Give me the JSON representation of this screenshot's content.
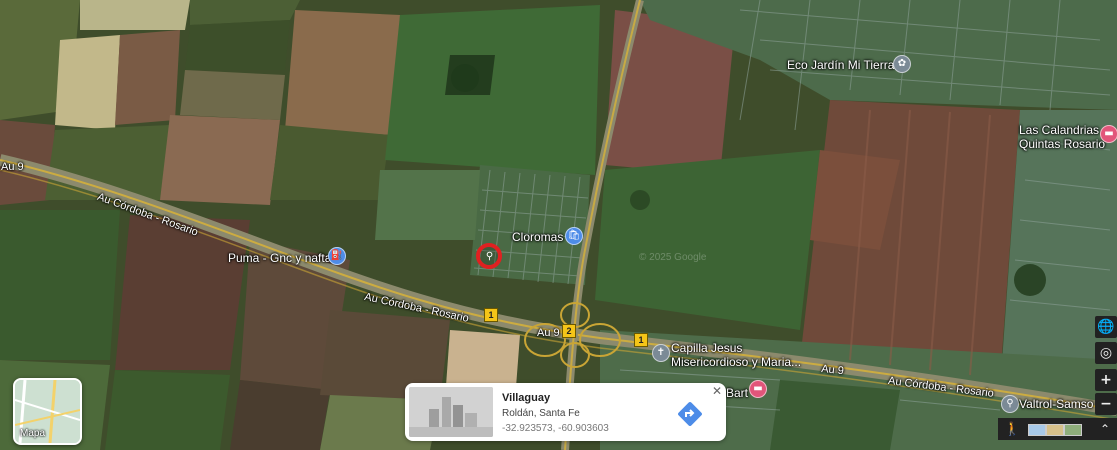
{
  "map": {
    "roads": {
      "au9_left": "Au 9",
      "au9_mid": "Au 9",
      "au9_right": "Au 9",
      "cordoba_rosario_1": "Au Córdoba - Rosario",
      "cordoba_rosario_2": "Au Córdoba - Rosario",
      "cordoba_rosario_3": "Au Córdoba - Rosario"
    },
    "shields": {
      "s1": "1",
      "s2": "2",
      "s3": "1"
    },
    "places": {
      "eco_jardin": "Eco Jardín Mi Tierra",
      "las_calandrias_1": "Las Calandrias",
      "las_calandrias_2": "Quintas Rosario",
      "cloromas": "Cloromas",
      "puma": "Puma - Gnc y nafta",
      "capilla_1": "Capilla Jesus",
      "capilla_2": "Misericordioso y Maria...",
      "valtrol": "Valtrol-Samso",
      "bart": "Bart"
    },
    "watermark": "© 2025 Google",
    "minimap_label": "Mapa"
  },
  "info_card": {
    "title": "Villaguay",
    "subtitle": "Roldán, Santa Fe",
    "coords": "-32.923573, -60.903603",
    "close": "✕"
  },
  "controls": {
    "globe": "🌐",
    "locate": "◎",
    "zoom_in": "+",
    "zoom_out": "−",
    "expand": "⌃"
  },
  "colors": {
    "marker": "#e02121",
    "highway": "#f5c518",
    "directions": "#4d8ce8"
  }
}
